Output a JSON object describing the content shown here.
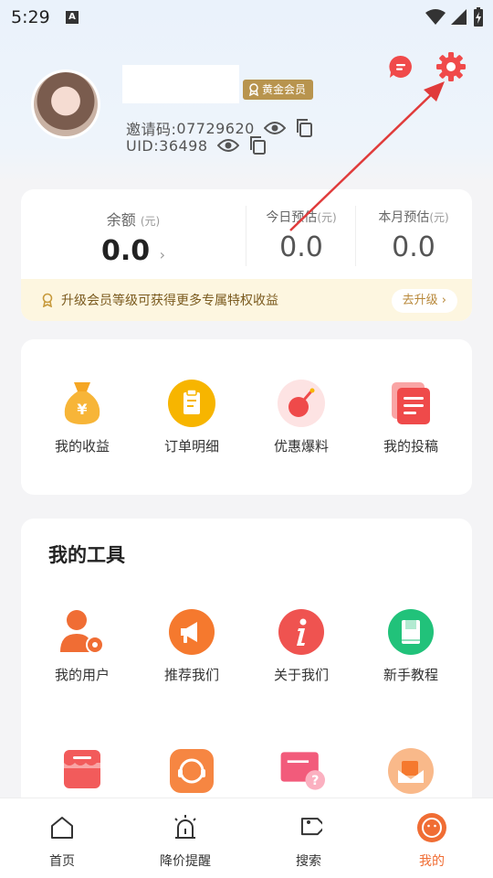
{
  "status_bar": {
    "time": "5:29",
    "notification_badge": "A"
  },
  "profile": {
    "vip_badge": "黄金会员",
    "invite_label": "邀请码: ",
    "invite_code": "07729620",
    "uid_label": "UID: ",
    "uid": "36498"
  },
  "balance": {
    "main_label": "余额",
    "main_unit": "(元)",
    "main_value": "0.0",
    "today_label": "今日预估",
    "today_unit": "(元)",
    "today_value": "0.0",
    "month_label": "本月预估",
    "month_unit": "(元)",
    "month_value": "0.0"
  },
  "upgrade": {
    "text": "升级会员等级可获得更多专属特权收益",
    "button": "去升级 ›"
  },
  "quick_menu": [
    {
      "label": "我的收益",
      "icon": "money-bag-icon",
      "color": "#f5a623"
    },
    {
      "label": "订单明细",
      "icon": "clipboard-icon",
      "color": "#f7b500"
    },
    {
      "label": "优惠爆料",
      "icon": "bomb-icon",
      "color": "#ef4a4a"
    },
    {
      "label": "我的投稿",
      "icon": "document-icon",
      "color": "#f25b5b"
    }
  ],
  "tools": {
    "title": "我的工具",
    "items": [
      {
        "label": "我的用户",
        "icon": "user-settings-icon",
        "color": "#f06d34"
      },
      {
        "label": "推荐我们",
        "icon": "megaphone-icon",
        "color": "#f5792e"
      },
      {
        "label": "关于我们",
        "icon": "info-icon",
        "color": "#ef5350"
      },
      {
        "label": "新手教程",
        "icon": "book-icon",
        "color": "#21c27a"
      }
    ]
  },
  "bottom_nav": [
    {
      "label": "首页",
      "icon": "home-icon"
    },
    {
      "label": "降价提醒",
      "icon": "alarm-icon"
    },
    {
      "label": "搜索",
      "icon": "tag-icon"
    },
    {
      "label": "我的",
      "icon": "profile-face-icon",
      "active": true
    }
  ]
}
